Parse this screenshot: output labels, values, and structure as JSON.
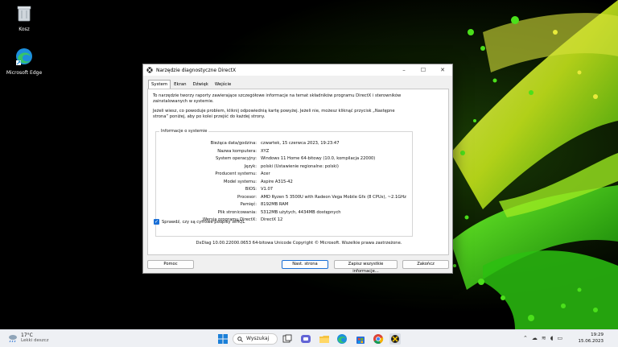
{
  "desktop": {
    "icons": [
      {
        "label": "Kosz"
      },
      {
        "label": "Microsoft Edge"
      }
    ]
  },
  "dialog": {
    "title": "Narzędzie diagnostyczne DirectX",
    "tabs": [
      "System",
      "Ekran",
      "Dźwięk",
      "Wejście"
    ],
    "intro1": "To narzędzie tworzy raporty zawierające szczegółowe informacje na temat składników programu DirectX i sterowników zainstalowanych w systemie.",
    "intro2": "Jeżeli wiesz, co powoduje problem, kliknij odpowiednią kartę powyżej. Jeżeli nie, możesz kliknąć przycisk „Następne strona” poniżej, aby po kolei przejść do każdej strony.",
    "group_label": "Informacje o systemie",
    "rows": [
      {
        "label": "Bieżąca data/godzina:",
        "value": "czwartek, 15 czerwca 2023, 19:23:47"
      },
      {
        "label": "Nazwa komputera:",
        "value": "XYZ"
      },
      {
        "label": "System operacyjny:",
        "value": "Windows 11 Home 64-bitowy (10.0, kompilacja 22000)"
      },
      {
        "label": "Język:",
        "value": "polski (Ustawienie regionalne: polski)"
      },
      {
        "label": "Producent systemu:",
        "value": "Acer"
      },
      {
        "label": "Model systemu:",
        "value": "Aspire A315-42"
      },
      {
        "label": "BIOS:",
        "value": "V1.07"
      },
      {
        "label": "Procesor:",
        "value": "AMD Ryzen 5 3500U with Radeon Vega Mobile Gfx   (8 CPUs), ~2.1GHz"
      },
      {
        "label": "Pamięć:",
        "value": "8192MB RAM"
      },
      {
        "label": "Plik stronicowania:",
        "value": "5312MB użytych, 4434MB dostępnych"
      },
      {
        "label": "Wersja programu DirectX:",
        "value": "DirectX 12"
      }
    ],
    "whql_label": "Sprawdź, czy są cyfrowe podpisy WHQL",
    "whql_checked": true,
    "copyright": "DxDiag 10.00.22000.0653 64-bitowa Unicode  Copyright © Microsoft. Wszelkie prawa zastrzeżone.",
    "buttons": {
      "help": "Pomoc",
      "next": "Nast. strona",
      "save": "Zapisz wszystkie informacje...",
      "close": "Zakończ"
    },
    "window_controls": {
      "minimize": "–",
      "maximize": "☐",
      "close": "✕"
    }
  },
  "taskbar": {
    "weather_temp": "17°C",
    "weather_desc": "Lekki deszcz",
    "search_label": "Wyszukaj",
    "time": "19:29",
    "date": "15.06.2023",
    "tray_icons": [
      "chevron-up-icon",
      "cloud-icon",
      "wifi-icon",
      "speaker-icon",
      "battery-icon"
    ]
  },
  "colors": {
    "accent": "#1a6fd6",
    "splash_green": "#3cd40a",
    "splash_yellow": "#e4e82a"
  }
}
